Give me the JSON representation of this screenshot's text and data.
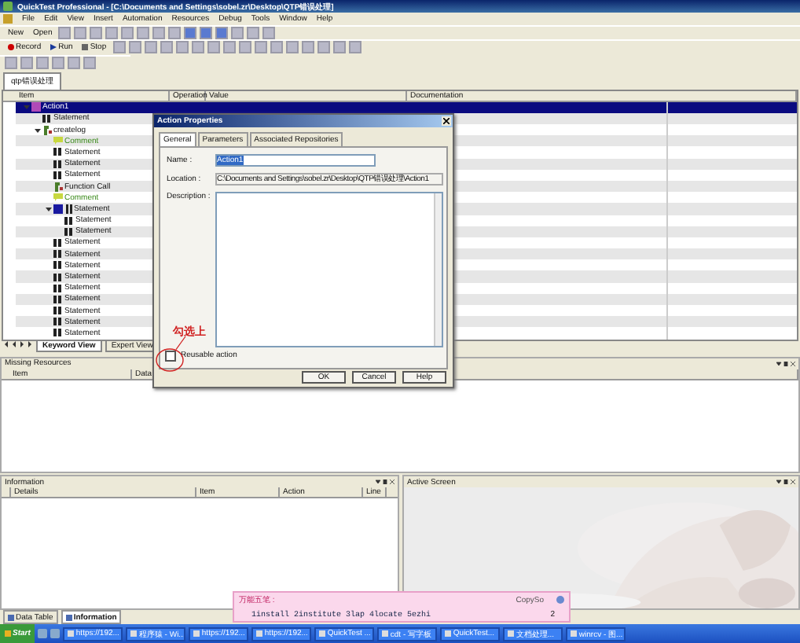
{
  "window": {
    "title": "QuickTest Professional - [C:\\Documents and Settings\\sobel.zr\\Desktop\\QTP错误处理]"
  },
  "menu": [
    "File",
    "Edit",
    "View",
    "Insert",
    "Automation",
    "Resources",
    "Debug",
    "Tools",
    "Window",
    "Help"
  ],
  "toolbar1": {
    "buttons": [
      {
        "label": "New"
      },
      {
        "label": "Open"
      }
    ]
  },
  "toolbar2": {
    "buttons": [
      {
        "label": "Record",
        "kind": "record"
      },
      {
        "label": "Run",
        "kind": "run"
      },
      {
        "label": "Stop",
        "kind": "stop"
      }
    ]
  },
  "document_tab": "qtp错误处理",
  "keyword_view": {
    "columns": [
      "Item",
      "Operation",
      "Value",
      "Documentation"
    ],
    "tree": [
      {
        "label": "Action1",
        "kind": "action",
        "selected": true,
        "expanded": true,
        "children": [
          {
            "label": "Statement",
            "kind": "statement",
            "selected": false
          },
          {
            "label": "createlog",
            "kind": "function",
            "selected": false,
            "expanded": true,
            "children": [
              {
                "label": "Comment",
                "kind": "comment",
                "selected": false
              },
              {
                "label": "Statement",
                "kind": "statement",
                "selected": false
              },
              {
                "label": "Statement",
                "kind": "statement",
                "selected": false
              },
              {
                "label": "Statement",
                "kind": "statement",
                "selected": false
              },
              {
                "label": "Function Call",
                "kind": "function",
                "selected": false
              },
              {
                "label": "Comment",
                "kind": "comment",
                "selected": false
              },
              {
                "label": "Statement",
                "kind": "block",
                "selected": false,
                "expanded": true,
                "children": [
                  {
                    "label": "Statement",
                    "kind": "statement",
                    "selected": false
                  },
                  {
                    "label": "Statement",
                    "kind": "statement",
                    "selected": false
                  }
                ]
              },
              {
                "label": "Statement",
                "kind": "statement",
                "selected": false
              },
              {
                "label": "Statement",
                "kind": "statement",
                "selected": false
              },
              {
                "label": "Statement",
                "kind": "statement",
                "selected": false
              },
              {
                "label": "Statement",
                "kind": "statement",
                "selected": false
              },
              {
                "label": "Statement",
                "kind": "statement",
                "selected": false
              },
              {
                "label": "Statement",
                "kind": "statement",
                "selected": false
              },
              {
                "label": "Statement",
                "kind": "statement",
                "selected": false
              },
              {
                "label": "Statement",
                "kind": "statement",
                "selected": false
              },
              {
                "label": "Statement",
                "kind": "statement",
                "selected": false
              }
            ]
          }
        ]
      }
    ]
  },
  "view_tabs": [
    {
      "label": "Keyword View",
      "selected": true
    },
    {
      "label": "Expert View",
      "selected": false
    }
  ],
  "missing_resources": {
    "title": "Missing Resources",
    "columns": [
      "Item",
      "Data"
    ]
  },
  "information": {
    "title": "Information",
    "columns": [
      "Details",
      "Item",
      "Action",
      "Line"
    ]
  },
  "active_screen": {
    "title": "Active Screen",
    "kind": "picture"
  },
  "bottom_tabs": [
    {
      "label": "Data Table",
      "selected": false
    },
    {
      "label": "Information",
      "selected": true
    }
  ],
  "dialog": {
    "title": "Action Properties",
    "tabs": [
      {
        "label": "General",
        "selected": true
      },
      {
        "label": "Parameters",
        "selected": false
      },
      {
        "label": "Associated Repositories",
        "selected": false
      }
    ],
    "name_label": "Name :",
    "name_value": "Action1",
    "location_label": "Location :",
    "location_value": "C:\\Documents and Settings\\sobel.zr\\Desktop\\QTP错误处理\\Action1",
    "description_label": "Description :",
    "annotation": "勾选上",
    "reusable": {
      "label": "Reusable action",
      "checked": false
    },
    "buttons": [
      "OK",
      "Cancel",
      "Help"
    ]
  },
  "ime": {
    "name": "万能五笔 :",
    "app": "CopySo",
    "candidates": "1install 2institute 3lap 4locate 5ezhi",
    "page": "2"
  },
  "taskbar": {
    "start": "Start",
    "items": [
      "https://192...",
      "程序猿 - Wi...",
      "https://192...",
      "https://192...",
      "QuickTest ...",
      "cdt - 写字板",
      "QuickTest...",
      "文档处理...",
      "winrcv - 图..."
    ]
  }
}
